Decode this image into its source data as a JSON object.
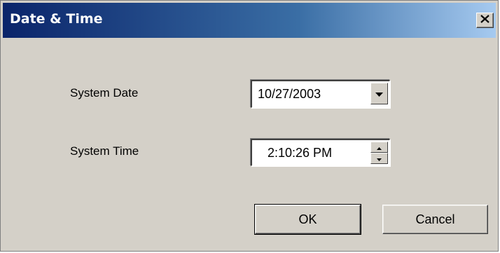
{
  "window": {
    "title": "Date & Time",
    "close_glyph": "✕"
  },
  "form": {
    "date_label": "System Date",
    "date_value": "10/27/2003",
    "time_label": "System Time",
    "time_value": "2:10:26 PM"
  },
  "buttons": {
    "ok_label": "OK",
    "cancel_label": "Cancel"
  },
  "icons": {
    "close": "close-icon",
    "dropdown": "chevron-down-icon",
    "spin_up": "spin-up-icon",
    "spin_down": "spin-down-icon"
  },
  "colors": {
    "titlebar_start": "#0a246a",
    "titlebar_end": "#a6caf0",
    "dialog_face": "#d4d0c8"
  }
}
